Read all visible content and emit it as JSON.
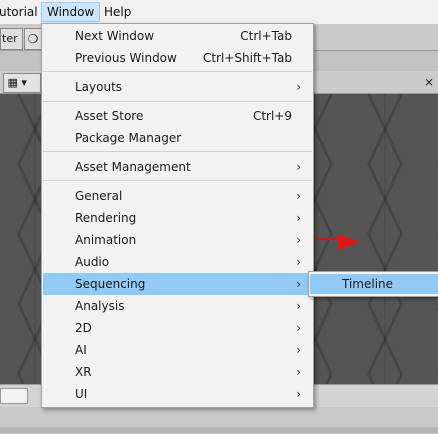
{
  "menubar": {
    "items": [
      {
        "label": "utorial"
      },
      {
        "label": "Window"
      },
      {
        "label": "Help"
      }
    ]
  },
  "editor": {
    "tab_left": "ter",
    "gizmo_icon": "grid-icon",
    "scene_handle_color": "#e01616"
  },
  "window_menu": {
    "items": [
      {
        "label": "Next Window",
        "shortcut": "Ctrl+Tab"
      },
      {
        "label": "Previous Window",
        "shortcut": "Ctrl+Shift+Tab"
      },
      {
        "label": "Layouts",
        "submenu": true
      },
      {
        "label": "Asset Store",
        "shortcut": "Ctrl+9"
      },
      {
        "label": "Package Manager"
      },
      {
        "label": "Asset Management",
        "submenu": true
      },
      {
        "label": "General",
        "submenu": true
      },
      {
        "label": "Rendering",
        "submenu": true
      },
      {
        "label": "Animation",
        "submenu": true
      },
      {
        "label": "Audio",
        "submenu": true
      },
      {
        "label": "Sequencing",
        "submenu": true,
        "highlighted": true
      },
      {
        "label": "Analysis",
        "submenu": true
      },
      {
        "label": "2D",
        "submenu": true
      },
      {
        "label": "AI",
        "submenu": true
      },
      {
        "label": "XR",
        "submenu": true
      },
      {
        "label": "UI",
        "submenu": true
      }
    ],
    "highlight_color": "#91c9f7"
  },
  "sequencing_submenu": {
    "items": [
      {
        "label": "Timeline"
      }
    ]
  }
}
